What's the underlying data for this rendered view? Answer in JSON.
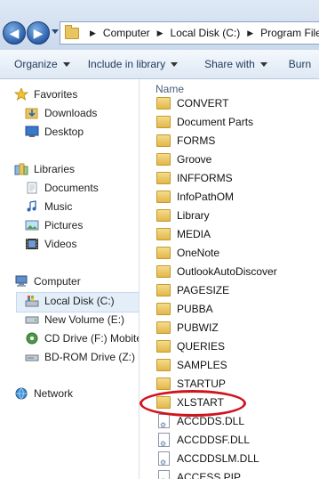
{
  "address": {
    "crumbs": [
      "Computer",
      "Local Disk (C:)",
      "Program Files"
    ]
  },
  "toolbar": {
    "organize": "Organize",
    "include": "Include in library",
    "share": "Share with",
    "burn": "Burn"
  },
  "nav": {
    "favorites": "Favorites",
    "downloads": "Downloads",
    "desktop": "Desktop",
    "libraries": "Libraries",
    "documents": "Documents",
    "music": "Music",
    "pictures": "Pictures",
    "videos": "Videos",
    "computer": "Computer",
    "local_disk": "Local Disk (C:)",
    "new_volume": "New Volume (E:)",
    "cd_drive": "CD Drive (F:) Mobite",
    "bd_drive": "BD-ROM Drive (Z:) O",
    "network": "Network"
  },
  "list": {
    "column_name": "Name",
    "folders": [
      "CONVERT",
      "Document Parts",
      "FORMS",
      "Groove",
      "INFFORMS",
      "InfoPathOM",
      "Library",
      "MEDIA",
      "OneNote",
      "OutlookAutoDiscover",
      "PAGESIZE",
      "PUBBA",
      "PUBWIZ",
      "QUERIES",
      "SAMPLES",
      "STARTUP",
      "XLSTART"
    ],
    "files": [
      "ACCDDS.DLL",
      "ACCDDSF.DLL",
      "ACCDDSLM.DLL",
      "ACCESS.PIP"
    ]
  },
  "colors": {
    "highlight_oval": "#d0141e",
    "selected_nav": "#e4eef9"
  }
}
